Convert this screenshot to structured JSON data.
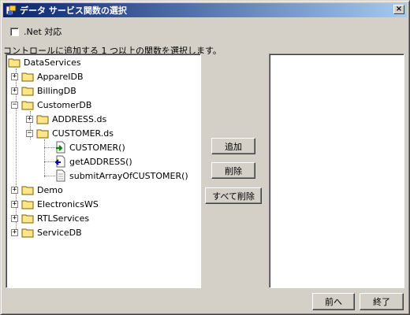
{
  "window": {
    "title": "データ サービス関数の選択",
    "close_label": "×"
  },
  "net_option": {
    "label": ".Net 対応"
  },
  "prompt": "コントロールに追加する 1 つ以上の関数を選択します。",
  "tree": {
    "root": "DataServices",
    "items": [
      {
        "label": "AppareIDB",
        "expander": "+"
      },
      {
        "label": "BillingDB",
        "expander": "+"
      },
      {
        "label": "CustomerDB",
        "expander": "−"
      },
      {
        "label": "ADDRESS.ds",
        "expander": "+"
      },
      {
        "label": "CUSTOMER.ds",
        "expander": "−"
      },
      {
        "label": "CUSTOMER()"
      },
      {
        "label": "getADDRESS()"
      },
      {
        "label": "submitArrayOfCUSTOMER()"
      },
      {
        "label": "Demo",
        "expander": "+"
      },
      {
        "label": "ElectronicsWS",
        "expander": "+"
      },
      {
        "label": "RTLServices",
        "expander": "+"
      },
      {
        "label": "ServiceDB",
        "expander": "+"
      }
    ]
  },
  "buttons": {
    "add": "追加",
    "remove": "削除",
    "remove_all": "すべて削除",
    "back": "前へ",
    "finish": "終了"
  },
  "colors": {
    "titlebar_start": "#0a246a",
    "titlebar_end": "#a6caf0",
    "face": "#d4d0c8",
    "folder": "#fde58a"
  }
}
